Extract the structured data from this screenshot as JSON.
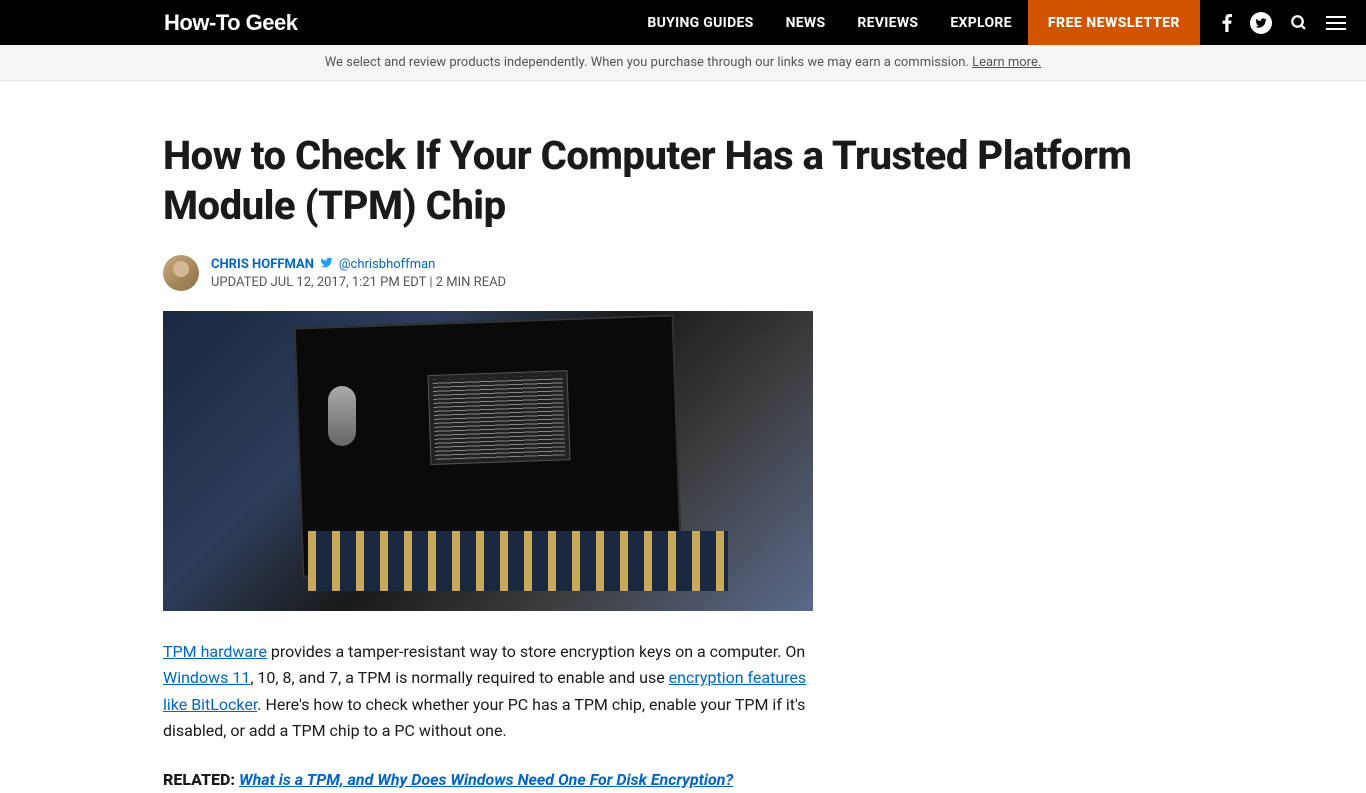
{
  "nav": {
    "logo": "How-To Geek",
    "links": [
      "BUYING GUIDES",
      "NEWS",
      "REVIEWS",
      "EXPLORE"
    ],
    "newsletter": "FREE NEWSLETTER"
  },
  "disclaimer": {
    "text": "We select and review products independently. When you purchase through our links we may earn a commission. ",
    "link": "Learn more."
  },
  "article": {
    "title": "How to Check If Your Computer Has a Trusted Platform Module (TPM) Chip",
    "author": "CHRIS HOFFMAN",
    "twitter": "@chrisbhoffman",
    "meta": "UPDATED JUL 12, 2017, 1:21 PM EDT | 2 MIN READ",
    "para1": {
      "link1": "TPM hardware",
      "t1": " provides a tamper-resistant way to store encryption keys on a computer. On ",
      "link2": "Windows 11",
      "t2": ", 10, 8, and 7, a TPM is normally required to enable and use ",
      "link3": "encryption features like BitLocker",
      "t3": ". Here's how to check whether your PC has a TPM chip, enable your TPM if it's disabled, or add a TPM chip to a PC without one."
    },
    "related": {
      "label": "RELATED:",
      "link": "What is a TPM, and Why Does Windows Need One For Disk Encryption?"
    }
  }
}
